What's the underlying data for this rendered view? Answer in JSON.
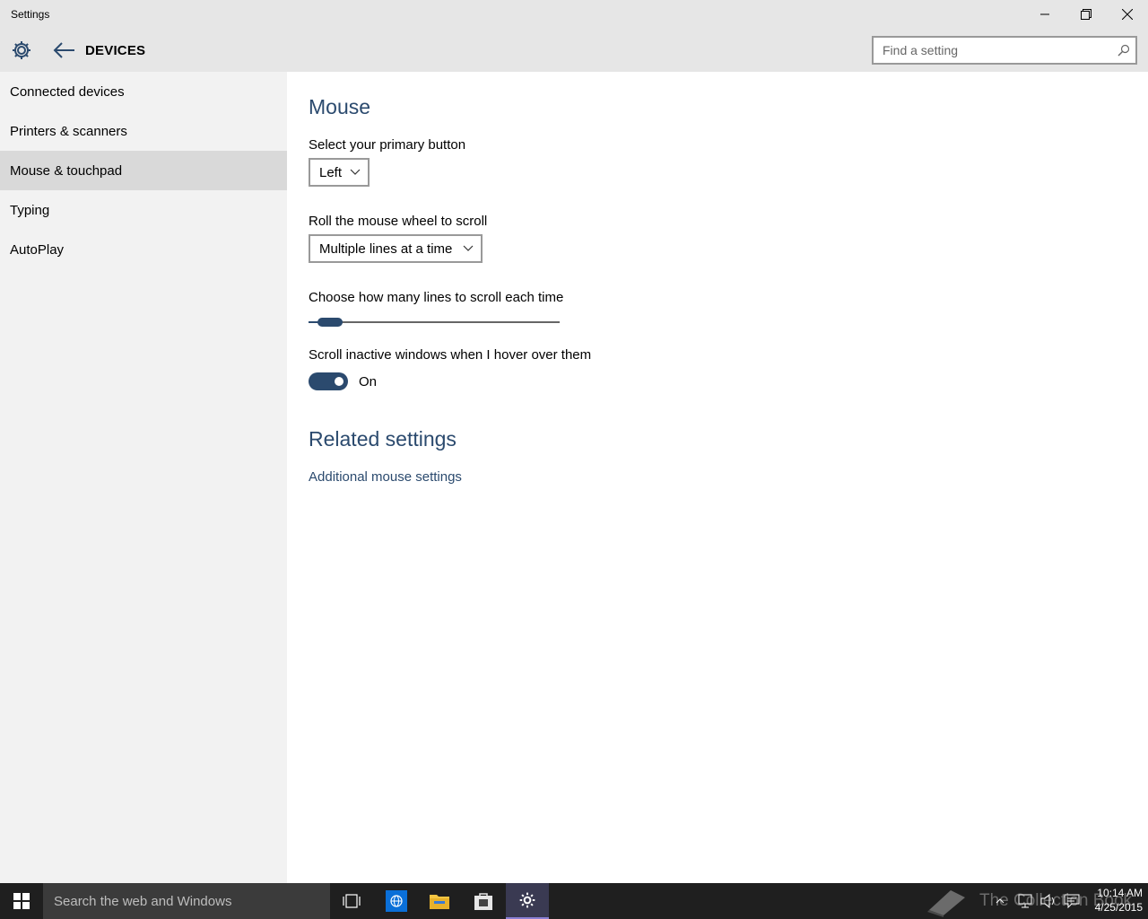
{
  "window": {
    "title": "Settings",
    "minimize_icon": "minimize-icon",
    "restore_icon": "restore-icon",
    "close_icon": "close-icon"
  },
  "header": {
    "section_title": "DEVICES",
    "search_placeholder": "Find a setting",
    "search_value": ""
  },
  "sidebar": {
    "items": [
      {
        "label": "Connected devices",
        "active": false
      },
      {
        "label": "Printers & scanners",
        "active": false
      },
      {
        "label": "Mouse & touchpad",
        "active": true
      },
      {
        "label": "Typing",
        "active": false
      },
      {
        "label": "AutoPlay",
        "active": false
      }
    ]
  },
  "main": {
    "title": "Mouse",
    "primary_button": {
      "label": "Select your primary button",
      "value": "Left"
    },
    "wheel_scroll": {
      "label": "Roll the mouse wheel to scroll",
      "value": "Multiple lines at a time"
    },
    "lines_slider": {
      "label": "Choose how many lines to scroll each time",
      "fraction": 0.04
    },
    "inactive_scroll": {
      "label": "Scroll inactive windows when I hover over them",
      "state": "On"
    },
    "related": {
      "title": "Related settings",
      "link": "Additional mouse settings"
    }
  },
  "taskbar": {
    "search_placeholder": "Search the web and Windows",
    "watermark": "The Collection Book",
    "time": "10:14 AM",
    "date": "4/25/2015"
  },
  "colors": {
    "accent": "#2b4a6e",
    "sidebar_bg": "#f2f2f2",
    "active_item_bg": "#d9d9d9",
    "titlebar_bg": "#e6e6e6",
    "taskbar_bg": "#1f1f1f"
  }
}
